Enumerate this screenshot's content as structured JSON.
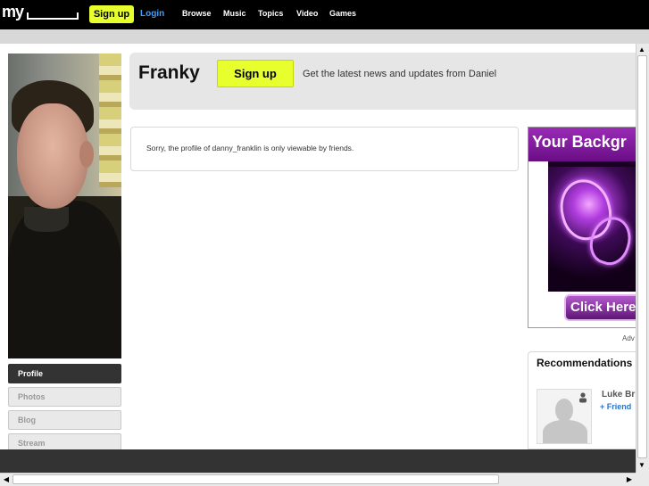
{
  "topbar": {
    "logo": "my",
    "signup_label": "Sign up",
    "login_label": "Login",
    "nav": [
      "Browse",
      "Music",
      "Topics",
      "Video",
      "Games"
    ]
  },
  "profile": {
    "name": "Franky",
    "signup_label": "Sign up",
    "news_text": "Get the latest news and updates from Daniel",
    "private_message": "Sorry, the profile of danny_franklin is only viewable by friends."
  },
  "menu": {
    "items": [
      "Profile",
      "Photos",
      "Blog",
      "Stream"
    ],
    "active": "Profile"
  },
  "ad": {
    "headline": "Your Backgr",
    "cta": "Click Here",
    "label": "Adv"
  },
  "recommendations": {
    "title": "Recommendations",
    "items": [
      {
        "name": "Luke Br",
        "action": "+ Friend"
      }
    ]
  },
  "colors": {
    "accent_yellow": "#e8ff2e",
    "topbar": "#000000",
    "link_blue": "#3fa0ff",
    "friend_blue": "#2a73c8"
  }
}
